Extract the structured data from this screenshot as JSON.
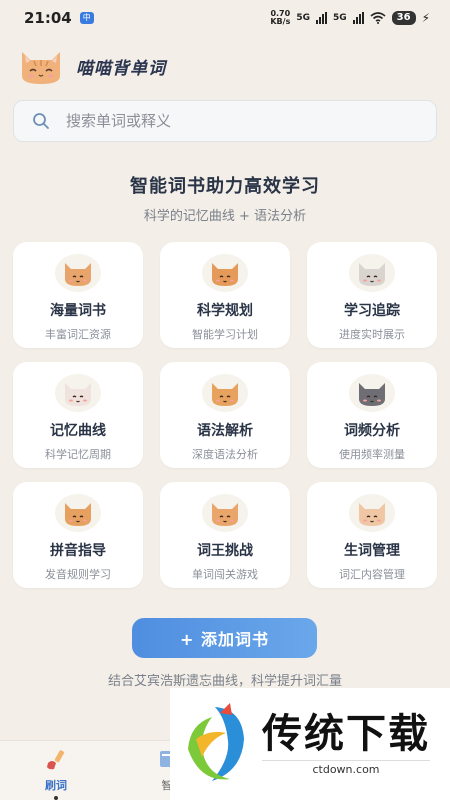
{
  "status_bar": {
    "time": "21:04",
    "app_badge": "中",
    "net_speed_value": "0.70",
    "net_speed_unit": "KB/s",
    "sim1": "5G",
    "sim2": "5G",
    "battery": "36"
  },
  "header": {
    "title": "喵喵背单词"
  },
  "search": {
    "placeholder": "搜索单词或释义"
  },
  "hero": {
    "headline": "智能词书助力高效学习",
    "subline": "科学的记忆曲线 + 语法分析"
  },
  "features": [
    {
      "title": "海量词书",
      "subtitle": "丰富词汇资源",
      "icon": "cat-icon",
      "color": "#e8a46a"
    },
    {
      "title": "科学规划",
      "subtitle": "智能学习计划",
      "icon": "cat-icon",
      "color": "#e59a5a"
    },
    {
      "title": "学习追踪",
      "subtitle": "进度实时展示",
      "icon": "cat-icon",
      "color": "#d9d4cf"
    },
    {
      "title": "记忆曲线",
      "subtitle": "科学记忆周期",
      "icon": "cat-icon",
      "color": "#f0e2dc"
    },
    {
      "title": "语法解析",
      "subtitle": "深度语法分析",
      "icon": "cat-icon",
      "color": "#e7a25e"
    },
    {
      "title": "词频分析",
      "subtitle": "使用频率测量",
      "icon": "cat-icon",
      "color": "#6e6e74"
    },
    {
      "title": "拼音指导",
      "subtitle": "发音规则学习",
      "icon": "cat-icon",
      "color": "#e6a160"
    },
    {
      "title": "词王挑战",
      "subtitle": "单词闯关游戏",
      "icon": "cat-icon",
      "color": "#eaa66a"
    },
    {
      "title": "生词管理",
      "subtitle": "词汇内容管理",
      "icon": "cat-icon",
      "color": "#efc7a4"
    }
  ],
  "add_button": {
    "label": "+ 添加词书"
  },
  "footer": {
    "text": "结合艾宾浩斯遗忘曲线，科学提升词汇量"
  },
  "nav": {
    "items": [
      {
        "label": "刷词",
        "icon": "brush-icon",
        "active": true
      },
      {
        "label": "智",
        "icon": "book-icon",
        "active": false
      }
    ]
  },
  "watermark": {
    "title": "传统下载",
    "url": "ctdown.com"
  },
  "colors": {
    "accent": "#4f8ee0",
    "background": "#f3eee7"
  }
}
